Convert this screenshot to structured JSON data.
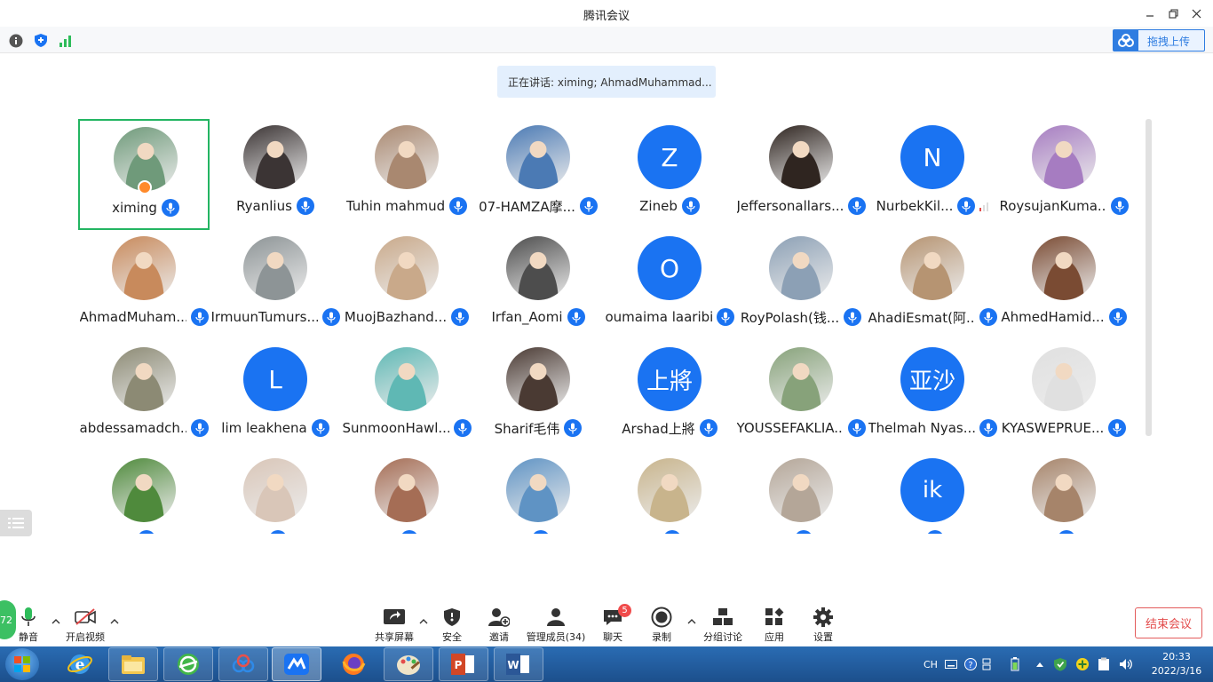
{
  "window": {
    "title": "腾讯会议"
  },
  "infobar": {
    "upload_label": "拖拽上传"
  },
  "speaking": {
    "text": "正在讲话: ximing; AhmadMuhammad..."
  },
  "participants": [
    {
      "name": "ximing",
      "avatar": "photo",
      "color": "#6f9a7a",
      "host": true
    },
    {
      "name": "Ryanlius",
      "avatar": "photo",
      "color": "#3b3434"
    },
    {
      "name": "Tuhin mahmud",
      "avatar": "photo",
      "color": "#a98870"
    },
    {
      "name": "07-HAMZA摩...",
      "avatar": "photo",
      "color": "#4b7ab4"
    },
    {
      "name": "Zineb",
      "avatar": "Z"
    },
    {
      "name": "Jeffersonallars...",
      "avatar": "photo",
      "color": "#2f2520"
    },
    {
      "name": "NurbekKil...",
      "avatar": "N",
      "signal": true
    },
    {
      "name": "RoysujanKuma...",
      "avatar": "photo",
      "color": "#a67cc1"
    },
    {
      "name": "AhmadMuham...",
      "avatar": "photo",
      "color": "#c88a5c"
    },
    {
      "name": "IrmuunTumurs...",
      "avatar": "photo",
      "color": "#8d9496"
    },
    {
      "name": "MuojBazhand...",
      "avatar": "photo",
      "color": "#c9a98a"
    },
    {
      "name": "Irfan_Aomi",
      "avatar": "photo",
      "color": "#4d4d4d"
    },
    {
      "name": "oumaima laaribi",
      "avatar": "O"
    },
    {
      "name": "RoyPolash(钱...",
      "avatar": "photo",
      "color": "#8ca0b5"
    },
    {
      "name": "AhadiEsmat(阿...",
      "avatar": "photo",
      "color": "#b69472"
    },
    {
      "name": "AhmedHamid...",
      "avatar": "photo",
      "color": "#7a4b33"
    },
    {
      "name": "abdessamadch...",
      "avatar": "photo",
      "color": "#8c8a74"
    },
    {
      "name": "lim leakhena",
      "avatar": "L"
    },
    {
      "name": "SunmoonHawl...",
      "avatar": "photo",
      "color": "#5fb8b4"
    },
    {
      "name": "Sharif毛伟",
      "avatar": "photo",
      "color": "#4a3a33"
    },
    {
      "name": "Arshad上將",
      "avatar": "上將"
    },
    {
      "name": "YOUSSEFAKLIA...",
      "avatar": "photo",
      "color": "#87a27a"
    },
    {
      "name": "Thelmah Nyas...",
      "avatar": "亚沙"
    },
    {
      "name": "KYASWEPRUE...",
      "avatar": "photo",
      "color": "#e0e0e0"
    },
    {
      "name": "",
      "avatar": "photo",
      "color": "#4f8a3c"
    },
    {
      "name": "",
      "avatar": "photo",
      "color": "#d9c6b8"
    },
    {
      "name": "",
      "avatar": "photo",
      "color": "#a56d55"
    },
    {
      "name": "",
      "avatar": "photo",
      "color": "#5f93c4"
    },
    {
      "name": "",
      "avatar": "photo",
      "color": "#c8b48c"
    },
    {
      "name": "",
      "avatar": "photo",
      "color": "#b4a698"
    },
    {
      "name": "",
      "avatar": "ik"
    },
    {
      "name": "",
      "avatar": "photo",
      "color": "#a6846a"
    }
  ],
  "toolbar": {
    "mute": "静音",
    "video": "开启视频",
    "share": "共享屏幕",
    "security": "安全",
    "invite": "邀请",
    "members": "管理成员(34)",
    "chat": "聊天",
    "chat_badge": "5",
    "record": "录制",
    "breakout": "分组讨论",
    "apps": "应用",
    "settings": "设置",
    "end": "结束会议",
    "level_badge": "72"
  },
  "taskbar": {
    "lang": "CH",
    "time": "20:33",
    "date": "2022/3/16"
  },
  "colors": {
    "accent": "#1a73f2",
    "active_border": "#23b562",
    "end_red": "#e34b4b",
    "taskbar": "#1c4f8c"
  }
}
